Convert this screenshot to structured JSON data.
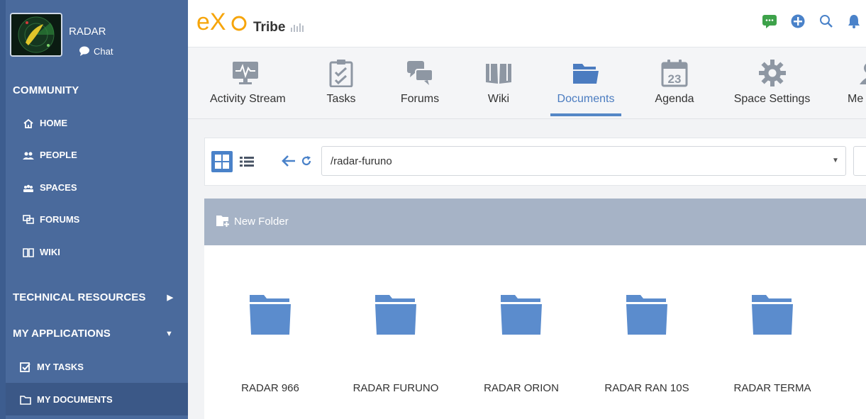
{
  "sidebar": {
    "space_name": "RADAR",
    "chat_label": "Chat",
    "community_heading": "COMMUNITY",
    "nav": [
      {
        "label": "HOME",
        "icon": "home-icon"
      },
      {
        "label": "PEOPLE",
        "icon": "people-icon"
      },
      {
        "label": "SPACES",
        "icon": "spaces-icon"
      },
      {
        "label": "FORUMS",
        "icon": "forums-icon"
      },
      {
        "label": "WIKI",
        "icon": "wiki-book-icon"
      }
    ],
    "technical_resources_heading": "TECHNICAL RESOURCES",
    "my_applications_heading": "MY APPLICATIONS",
    "apps": [
      {
        "label": "MY TASKS",
        "icon": "task-checkbox-icon"
      },
      {
        "label": "MY DOCUMENTS",
        "icon": "folder-outline-icon",
        "active": true
      }
    ]
  },
  "topbar": {
    "logo_text": "eXo",
    "company_name": "Tribe",
    "icons": [
      "chat-bubble-icon",
      "add-circle-icon",
      "search-icon",
      "notification-bell-icon"
    ]
  },
  "tabs": [
    {
      "label": "Activity Stream",
      "icon": "activity-stream-icon"
    },
    {
      "label": "Tasks",
      "icon": "tasks-clipboard-icon"
    },
    {
      "label": "Forums",
      "icon": "forums-bubbles-icon"
    },
    {
      "label": "Wiki",
      "icon": "wiki-book-icon"
    },
    {
      "label": "Documents",
      "icon": "documents-folder-icon",
      "active": true
    },
    {
      "label": "Agenda",
      "icon": "calendar-icon",
      "day": "23"
    },
    {
      "label": "Space Settings",
      "icon": "gear-icon"
    },
    {
      "label": "Me",
      "icon": "members-icon"
    }
  ],
  "documents": {
    "path": "/radar-furuno",
    "new_folder_label": "New Folder",
    "folders": [
      "RADAR 966",
      "RADAR FURUNO",
      "RADAR ORION",
      "RADAR RAN 10S",
      "RADAR TERMA"
    ]
  },
  "colors": {
    "sidebar": "#4a6a9c",
    "accent": "#5587c6",
    "logo_orange": "#f6a50b",
    "action_bar": "#a6b3c6",
    "folder": "#5b8ccd"
  }
}
